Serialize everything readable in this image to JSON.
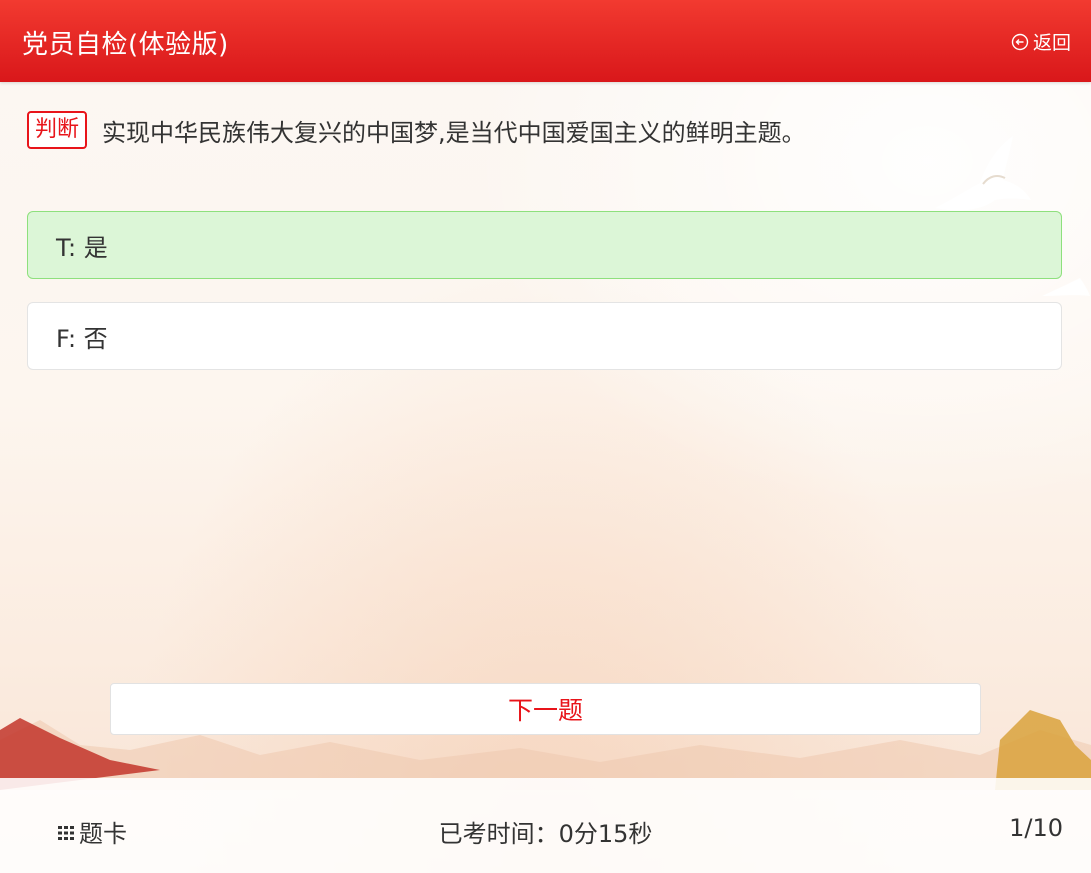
{
  "header": {
    "title": "党员自检(体验版)",
    "back_label": "返回",
    "back_icon": "circle-arrow-left-icon"
  },
  "question": {
    "type_label": "判断",
    "text": "实现中华民族伟大复兴的中国梦,是当代中国爱国主义的鲜明主题。"
  },
  "options": [
    {
      "label": "T: 是",
      "state": "selected",
      "color": "#dcf6d7"
    },
    {
      "label": "F: 否",
      "state": "default",
      "color": "#ffffff"
    }
  ],
  "next_button": {
    "label": "下一题"
  },
  "footer": {
    "card_icon": "grid-icon",
    "card_label": "题卡",
    "timer": "已考时间：0分15秒",
    "progress": "1/10"
  },
  "colors": {
    "brand_red": "#e8141a",
    "correct_green": "#8ee07d"
  }
}
